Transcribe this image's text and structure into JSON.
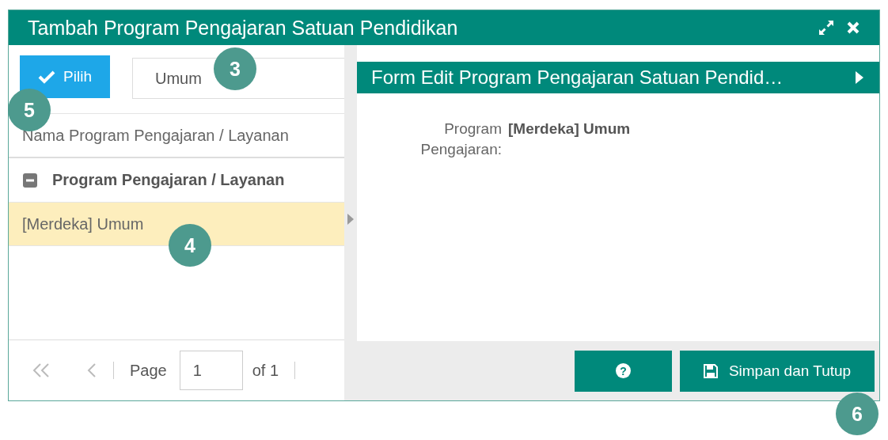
{
  "window": {
    "title": "Tambah Program Pengajaran Satuan Pendidikan"
  },
  "left": {
    "pick_button": "Pilih",
    "search": {
      "value": "Umum"
    },
    "filter": {
      "placeholder": "Nama Program Pengajaran / Layanan"
    },
    "tree": {
      "label": "Program Pengajaran / Layanan",
      "expanded": true,
      "children": [
        {
          "label": "[Merdeka] Umum",
          "selected": true
        }
      ]
    },
    "pager": {
      "page_label": "Page",
      "page": "1",
      "of": "of 1"
    }
  },
  "form": {
    "title": "Form Edit Program Pengajaran Satuan Pendid…",
    "fields": [
      {
        "label": "Program Pengajaran:",
        "value": "[Merdeka] Umum"
      }
    ]
  },
  "buttons": [
    {
      "kind": "help",
      "label": "?"
    },
    {
      "kind": "save",
      "label": "Simpan dan Tutup"
    }
  ],
  "callouts": [
    {
      "label": "3"
    },
    {
      "label": "5"
    },
    {
      "label": "4"
    },
    {
      "label": "6"
    }
  ]
}
